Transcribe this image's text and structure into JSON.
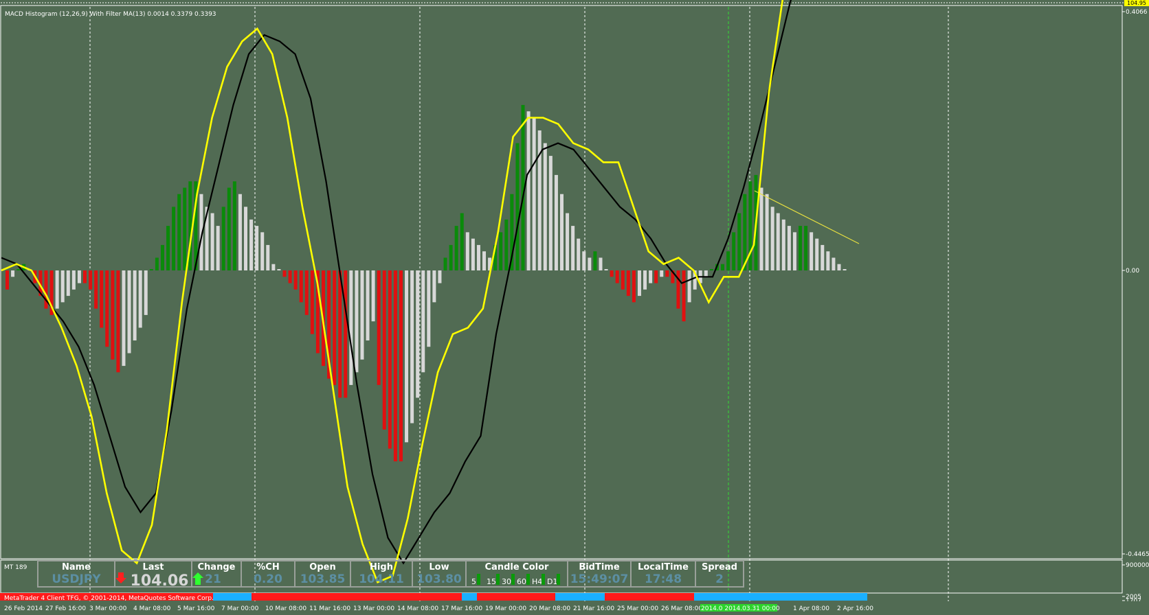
{
  "indicator_label": "MACD Histogram (12,26,9) With Filter MA(13) 0.0014 0.3379 0.3393",
  "price_right_top": "104.95",
  "axis_labels": {
    "top": "0.4066",
    "zero": "0.00",
    "bottom": "-0.4465",
    "sub1": "9000000",
    "sub2": "2005",
    "sub3": "1707"
  },
  "panel": {
    "tag": "MT 189",
    "headers": [
      "Name",
      "Last",
      "Change",
      "%CH",
      "Open",
      "High",
      "Low",
      "Candle Color",
      "BidTime",
      "LocalTime",
      "Spread"
    ],
    "name": "USDJPY",
    "last": "104.06",
    "change": "21",
    "pct": "0.20",
    "open": "103.85",
    "high": "104.11",
    "low": "103.80",
    "candle_tfs": [
      "5",
      "15",
      "30",
      "60",
      "H4",
      "D1"
    ],
    "bidtime": "15:49:07",
    "localtime": "17:48",
    "spread": "2"
  },
  "copyright": "MetaTrader 4 Client TFG, © 2001-2014, MetaQuotes Software Corp.",
  "overlap_text": "2014.03.31 00:00",
  "time_labels": [
    "26 Feb 2014",
    "27 Feb 16:00",
    "3 Mar 00:00",
    "4 Mar 08:00",
    "5 Mar 16:00",
    "7 Mar 00:00",
    "10 Mar 08:00",
    "11 Mar 16:00",
    "13 Mar 00:00",
    "14 Mar 08:00",
    "17 Mar 16:00",
    "19 Mar 00:00",
    "20 Mar 08:00",
    "21 Mar 16:00",
    "25 Mar 00:00",
    "26 Mar 08:00",
    "2014.0 2014.03.31 00:00",
    "1 Apr 08:00",
    "2 Apr 16:00"
  ],
  "colors": {
    "background": "#516b53",
    "bull_rising": "#0a8a0a",
    "bull_falling": "#d8d8d8",
    "bear": "#e01010",
    "fast_line": "#ffff00",
    "slow_line": "#000000",
    "trend_line": "#e8e040",
    "strip_red": "#ff1a1a",
    "strip_blue": "#1ab0ff"
  },
  "chart_data": {
    "type": "bar",
    "title": "MACD Histogram (12,26,9) With Filter MA(13) 0.0014 0.3379 0.3393",
    "ylim": [
      -0.4465,
      0.4066
    ],
    "y_ticks": [
      0.4066,
      0,
      -0.4465
    ],
    "grid": true,
    "histogram": [
      -0.03,
      -0.01,
      0.0,
      0.01,
      0.0,
      -0.02,
      -0.04,
      -0.06,
      -0.07,
      -0.06,
      -0.05,
      -0.04,
      -0.03,
      -0.02,
      -0.02,
      -0.03,
      -0.06,
      -0.09,
      -0.12,
      -0.14,
      -0.16,
      -0.15,
      -0.13,
      -0.11,
      -0.09,
      -0.07,
      0.0,
      0.02,
      0.04,
      0.07,
      0.1,
      0.12,
      0.13,
      0.14,
      0.14,
      0.12,
      0.1,
      0.09,
      0.07,
      0.1,
      0.13,
      0.14,
      0.12,
      0.1,
      0.08,
      0.07,
      0.06,
      0.04,
      0.01,
      0.0,
      -0.01,
      -0.02,
      -0.03,
      -0.05,
      -0.07,
      -0.1,
      -0.13,
      -0.15,
      -0.17,
      -0.18,
      -0.2,
      -0.2,
      -0.18,
      -0.16,
      -0.14,
      -0.11,
      -0.08,
      -0.18,
      -0.25,
      -0.28,
      -0.3,
      -0.3,
      -0.27,
      -0.24,
      -0.2,
      -0.16,
      -0.12,
      -0.05,
      -0.02,
      0.02,
      0.04,
      0.07,
      0.09,
      0.06,
      0.05,
      0.04,
      0.03,
      0.02,
      0.04,
      0.06,
      0.08,
      0.12,
      0.2,
      0.26,
      0.25,
      0.24,
      0.22,
      0.2,
      0.18,
      0.15,
      0.12,
      0.09,
      0.07,
      0.05,
      0.03,
      0.02,
      0.03,
      0.02,
      0.0,
      -0.01,
      -0.02,
      -0.03,
      -0.04,
      -0.05,
      -0.04,
      -0.03,
      -0.02,
      -0.02,
      -0.01,
      -0.01,
      -0.02,
      -0.06,
      -0.08,
      -0.05,
      -0.03,
      -0.02,
      -0.01,
      0.0,
      0.01,
      0.01,
      0.03,
      0.06,
      0.09,
      0.12,
      0.14,
      0.15,
      0.13,
      0.12,
      0.1,
      0.09,
      0.08,
      0.07,
      0.06,
      0.07,
      0.07,
      0.06,
      0.05,
      0.04,
      0.03,
      0.02,
      0.01,
      0.0
    ],
    "fast_line": [
      0.0,
      0.01,
      0.0,
      -0.04,
      -0.09,
      -0.15,
      -0.23,
      -0.35,
      -0.44,
      -0.46,
      -0.4,
      -0.25,
      -0.05,
      0.12,
      0.24,
      0.32,
      0.36,
      0.38,
      0.34,
      0.24,
      0.1,
      -0.02,
      -0.18,
      -0.34,
      -0.43,
      -0.49,
      -0.48,
      -0.39,
      -0.27,
      -0.16,
      -0.1,
      -0.09,
      -0.06,
      0.06,
      0.21,
      0.24,
      0.24,
      0.23,
      0.2,
      0.19,
      0.17,
      0.17,
      0.1,
      0.03,
      0.01,
      0.02,
      0.0,
      -0.05,
      -0.01,
      -0.01,
      0.04,
      0.28,
      0.44,
      0.5,
      0.52,
      0.58,
      0.62,
      0.59,
      0.58
    ],
    "slow_line": [
      0.02,
      0.01,
      -0.02,
      -0.05,
      -0.08,
      -0.12,
      -0.18,
      -0.26,
      -0.34,
      -0.38,
      -0.35,
      -0.22,
      -0.06,
      0.06,
      0.16,
      0.26,
      0.34,
      0.37,
      0.36,
      0.34,
      0.27,
      0.14,
      -0.02,
      -0.18,
      -0.32,
      -0.42,
      -0.46,
      -0.42,
      -0.38,
      -0.35,
      -0.3,
      -0.26,
      -0.1,
      0.02,
      0.15,
      0.19,
      0.2,
      0.19,
      0.16,
      0.13,
      0.1,
      0.08,
      0.05,
      0.01,
      -0.02,
      -0.01,
      -0.01,
      0.05,
      0.13,
      0.22,
      0.32,
      0.42,
      0.5,
      0.56,
      0.59,
      0.58
    ]
  }
}
